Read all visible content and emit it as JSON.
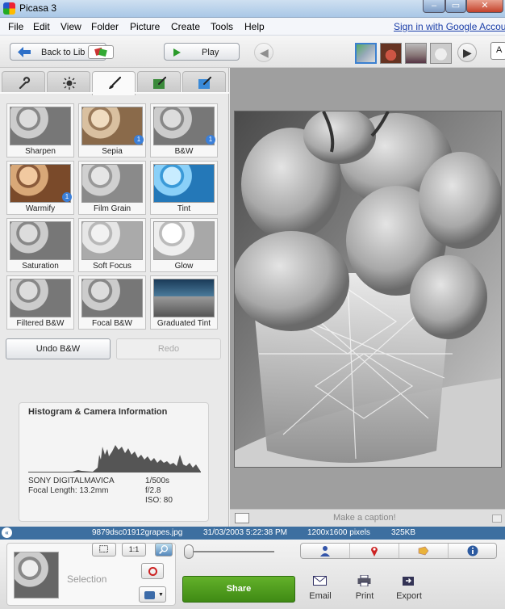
{
  "window": {
    "title": "Picasa 3",
    "controls": [
      "–",
      "▭",
      "✕"
    ]
  },
  "menu": {
    "items": [
      "File",
      "Edit",
      "View",
      "Folder",
      "Picture",
      "Create",
      "Tools",
      "Help"
    ],
    "sign_in": "Sign in with Google Account"
  },
  "toolbar": {
    "back_label": "Back to Lib",
    "play_label": "Play",
    "right_edge_label": "A"
  },
  "tabs": [
    {
      "name": "basic-fixes",
      "icon": "wrench-icon",
      "active": false
    },
    {
      "name": "tuning",
      "icon": "sun-icon",
      "active": false
    },
    {
      "name": "effects",
      "icon": "brush-icon",
      "active": true
    },
    {
      "name": "more-effects-1",
      "icon": "green-brush-icon",
      "active": false
    },
    {
      "name": "more-effects-2",
      "icon": "blue-brush-icon",
      "active": false
    }
  ],
  "effects": [
    {
      "label": "Sharpen",
      "style": "gray",
      "badge": ""
    },
    {
      "label": "Sepia",
      "style": "sepia",
      "badge": "1"
    },
    {
      "label": "B&W",
      "style": "gray",
      "badge": "1"
    },
    {
      "label": "Warmify",
      "style": "warm",
      "badge": "1"
    },
    {
      "label": "Film Grain",
      "style": "grain",
      "badge": ""
    },
    {
      "label": "Tint",
      "style": "tint",
      "badge": ""
    },
    {
      "label": "Saturation",
      "style": "gray",
      "badge": ""
    },
    {
      "label": "Soft Focus",
      "style": "soft",
      "badge": ""
    },
    {
      "label": "Glow",
      "style": "glow",
      "badge": ""
    },
    {
      "label": "Filtered B&W",
      "style": "gray",
      "badge": ""
    },
    {
      "label": "Focal B&W",
      "style": "gray",
      "badge": ""
    },
    {
      "label": "Graduated Tint",
      "style": "grad",
      "badge": ""
    }
  ],
  "actions": {
    "undo_label": "Undo B&W",
    "redo_label": "Redo"
  },
  "histogram": {
    "title": "Histogram & Camera Information",
    "camera": "SONY DIGITALMAVICA",
    "focal_length": "Focal Length: 13.2mm",
    "shutter": "1/500s",
    "aperture": "f/2.8",
    "iso": "ISO: 80"
  },
  "caption": {
    "placeholder": "Make a caption!"
  },
  "info": {
    "filename": "9879dsc01912grapes.jpg",
    "date": "31/03/2003 5:22:38 PM",
    "dimensions": "1200x1600 pixels",
    "size": "325KB"
  },
  "bottom": {
    "selection_label": "Selection",
    "one_to_one": "1:1",
    "share_label": "Share",
    "email_label": "Email",
    "print_label": "Print",
    "export_label": "Export"
  },
  "colors": {
    "accent": "#3b7fd8",
    "info_strip": "#3d6fa0",
    "share_green": "#4f9c1e",
    "link": "#1a3ea8"
  }
}
